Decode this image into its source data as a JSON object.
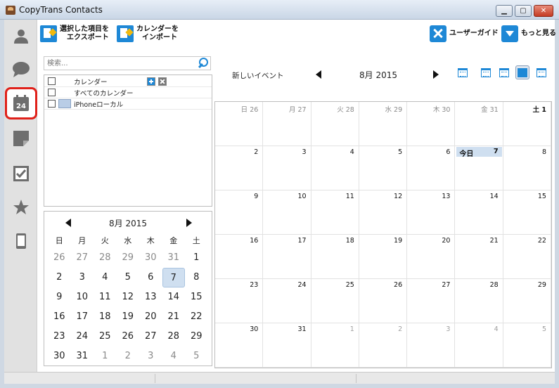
{
  "window": {
    "title": "CopyTrans Contacts",
    "min_label": "▁",
    "max_label": "▢",
    "close_label": "✕"
  },
  "rail": [
    {
      "name": "rail-contacts",
      "icon": "person-icon"
    },
    {
      "name": "rail-messages",
      "icon": "speech-bubble-icon"
    },
    {
      "name": "rail-calendar",
      "icon": "calendar-icon",
      "active": true,
      "badge": "24"
    },
    {
      "name": "rail-notes",
      "icon": "note-icon"
    },
    {
      "name": "rail-tasks",
      "icon": "checkbox-icon"
    },
    {
      "name": "rail-favorites",
      "icon": "star-icon"
    },
    {
      "name": "rail-device",
      "icon": "phone-icon"
    }
  ],
  "toolbar": {
    "export_line1": "選択した項目を",
    "export_line2": "エクスポート",
    "import_line1": "カレンダーを",
    "import_line2": "インポート",
    "guide_label": "ユーザーガイド",
    "more_label": "もっと見る"
  },
  "search": {
    "placeholder": "検索..."
  },
  "calendar_list": {
    "header": "カレンダー",
    "all": "すべてのカレンダー",
    "items": [
      {
        "label": "iPhoneローカル",
        "color": "#b9cde6"
      }
    ]
  },
  "mini_calendar": {
    "title": "8月 2015",
    "dow": [
      "日",
      "月",
      "火",
      "水",
      "木",
      "金",
      "土"
    ],
    "weeks": [
      [
        "26",
        "27",
        "28",
        "29",
        "30",
        "31",
        "1"
      ],
      [
        "2",
        "3",
        "4",
        "5",
        "6",
        "7",
        "8"
      ],
      [
        "9",
        "10",
        "11",
        "12",
        "13",
        "14",
        "15"
      ],
      [
        "16",
        "17",
        "18",
        "19",
        "20",
        "21",
        "22"
      ],
      [
        "23",
        "24",
        "25",
        "26",
        "27",
        "28",
        "29"
      ],
      [
        "30",
        "31",
        "1",
        "2",
        "3",
        "4",
        "5"
      ]
    ],
    "selected": "7"
  },
  "month_view": {
    "new_event": "新しいイベント",
    "title": "8月 2015",
    "today_label": "今日",
    "first_row": [
      "日 26",
      "月 27",
      "火 28",
      "水 29",
      "木 30",
      "金 31",
      "土 1"
    ],
    "rows": [
      [
        "2",
        "3",
        "4",
        "5",
        "6",
        "7",
        "8"
      ],
      [
        "9",
        "10",
        "11",
        "12",
        "13",
        "14",
        "15"
      ],
      [
        "16",
        "17",
        "18",
        "19",
        "20",
        "21",
        "22"
      ],
      [
        "23",
        "24",
        "25",
        "26",
        "27",
        "28",
        "29"
      ],
      [
        "30",
        "31",
        "1",
        "2",
        "3",
        "4",
        "5"
      ]
    ],
    "views": [
      "day-view-icon",
      "week-view-icon",
      "workweek-view-icon",
      "month-view-icon",
      "list-view-icon"
    ],
    "active_view": "month-view-icon"
  },
  "colors": {
    "accent": "#1e88d6",
    "highlight": "#cfdff0",
    "active_outline": "#e0211a"
  }
}
